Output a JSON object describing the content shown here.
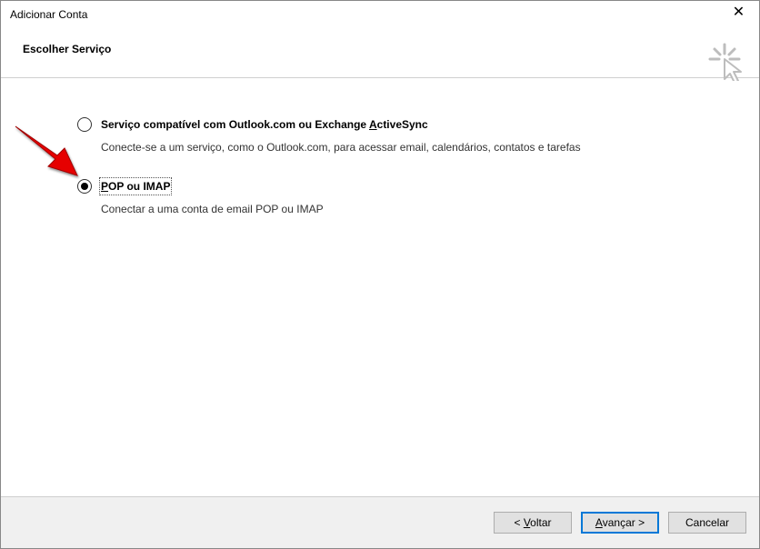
{
  "window": {
    "title": "Adicionar Conta"
  },
  "header": {
    "heading": "Escolher Serviço"
  },
  "options": {
    "outlook": {
      "title_pre": "Serviço compatível com Outlook.com ou Exchange ",
      "title_access": "A",
      "title_post": "ctiveSync",
      "desc": "Conecte-se a um serviço, como o Outlook.com, para acessar email, calendários, contatos e tarefas",
      "selected": false
    },
    "pop": {
      "title_access": "P",
      "title_post": "OP ou IMAP",
      "desc": "Conectar a uma conta de email POP ou IMAP",
      "selected": true
    }
  },
  "footer": {
    "back_sym": "< ",
    "back_access": "V",
    "back_post": "oltar",
    "next_access": "A",
    "next_post": "vançar >",
    "cancel": "Cancelar"
  }
}
